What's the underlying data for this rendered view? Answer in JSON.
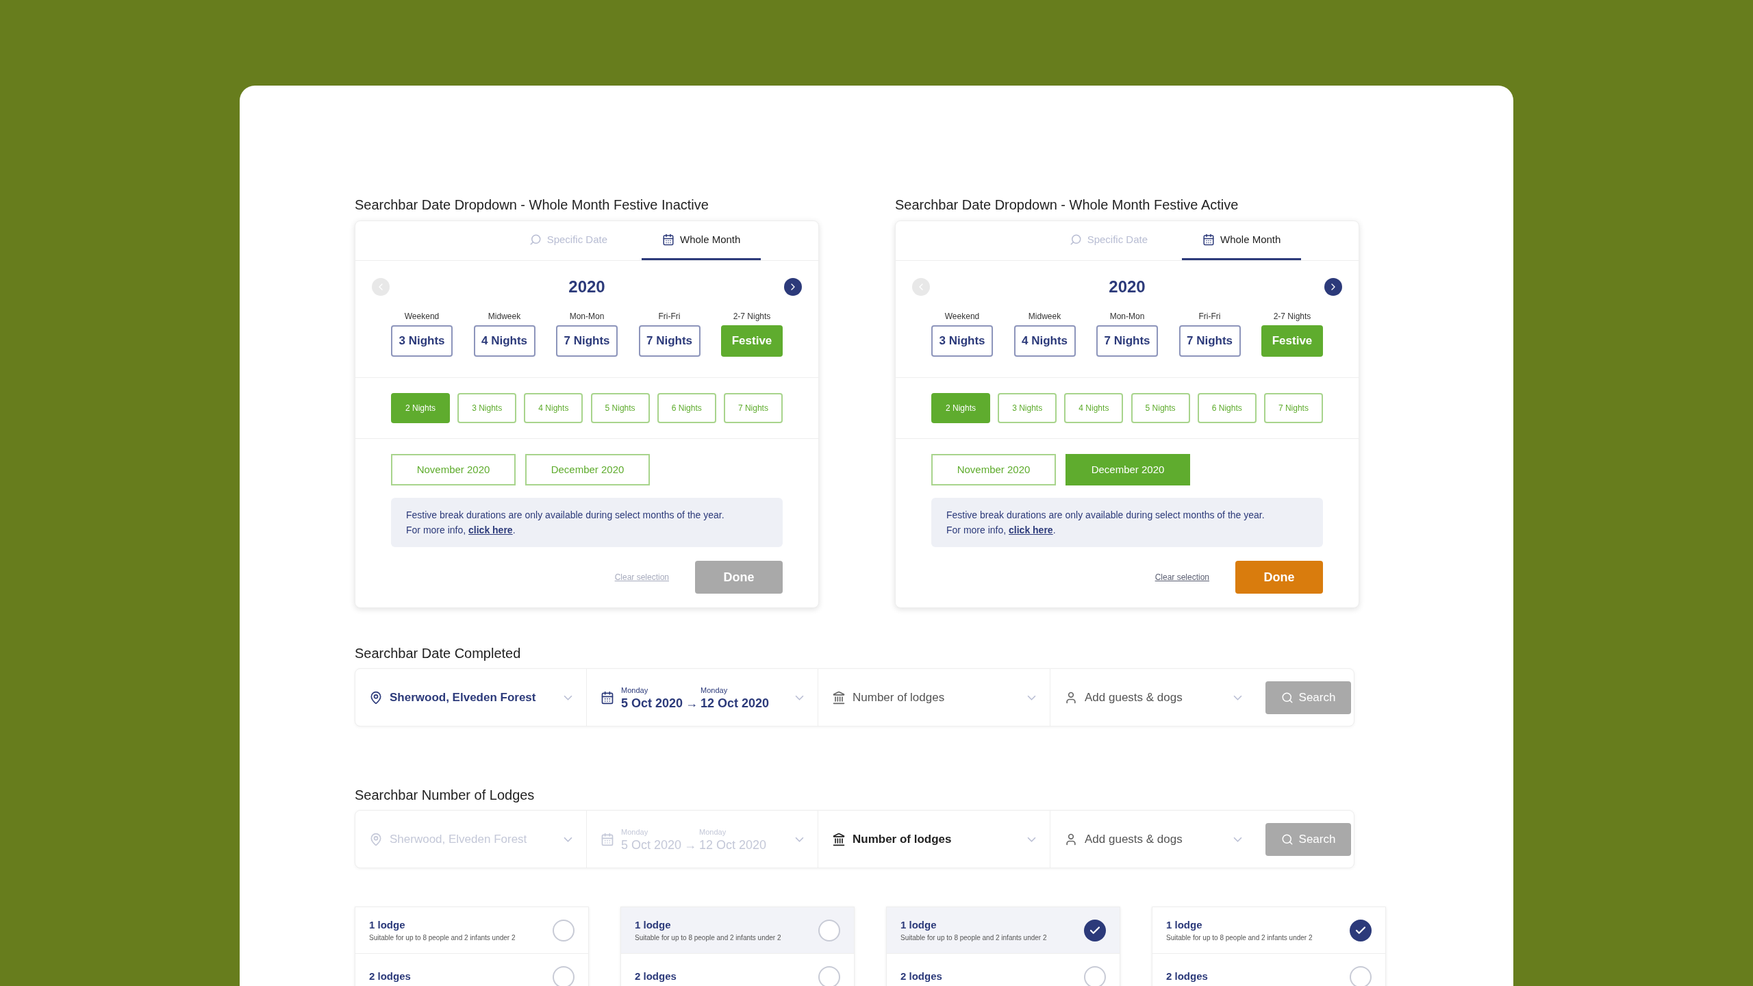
{
  "dropdowns": [
    {
      "title": "Searchbar Date Dropdown - Whole Month Festive Inactive",
      "tabs": [
        {
          "label": "Specific Date",
          "selected": false
        },
        {
          "label": "Whole Month",
          "selected": true
        }
      ],
      "prev": {
        "disabled": true
      },
      "next": {
        "disabled": false
      },
      "year": "2020",
      "durations": [
        {
          "caption": "Weekend",
          "label": "3 Nights",
          "selected": false
        },
        {
          "caption": "Midweek",
          "label": "4 Nights",
          "selected": false
        },
        {
          "caption": "Mon-Mon",
          "label": "7 Nights",
          "selected": false
        },
        {
          "caption": "Fri-Fri",
          "label": "7 Nights",
          "selected": false
        },
        {
          "caption": "2-7 Nights",
          "label": "Festive",
          "selected": true
        }
      ],
      "nights": [
        {
          "label": "2 Nights",
          "selected": true
        },
        {
          "label": "3 Nights",
          "selected": false
        },
        {
          "label": "4 Nights",
          "selected": false
        },
        {
          "label": "5 Nights",
          "selected": false
        },
        {
          "label": "6 Nights",
          "selected": false
        },
        {
          "label": "7 Nights",
          "selected": false
        }
      ],
      "months": [
        {
          "label": "November 2020",
          "selected": false
        },
        {
          "label": "December 2020",
          "selected": false
        }
      ],
      "notice": {
        "line_1": "Festive break durations are only available during select months of the year.",
        "line_2": "For more info,",
        "link": "click here",
        "after": "."
      },
      "clear": {
        "label": "Clear selection",
        "disabled": true
      },
      "done": {
        "label": "Done",
        "disabled": true
      }
    },
    {
      "title": "Searchbar Date Dropdown - Whole Month Festive Active",
      "tabs": [
        {
          "label": "Specific Date",
          "selected": false
        },
        {
          "label": "Whole Month",
          "selected": true
        }
      ],
      "prev": {
        "disabled": true
      },
      "next": {
        "disabled": false
      },
      "year": "2020",
      "durations": [
        {
          "caption": "Weekend",
          "label": "3 Nights",
          "selected": false
        },
        {
          "caption": "Midweek",
          "label": "4 Nights",
          "selected": false
        },
        {
          "caption": "Mon-Mon",
          "label": "7 Nights",
          "selected": false
        },
        {
          "caption": "Fri-Fri",
          "label": "7 Nights",
          "selected": false
        },
        {
          "caption": "2-7 Nights",
          "label": "Festive",
          "selected": true
        }
      ],
      "nights": [
        {
          "label": "2 Nights",
          "selected": true
        },
        {
          "label": "3 Nights",
          "selected": false
        },
        {
          "label": "4 Nights",
          "selected": false
        },
        {
          "label": "5 Nights",
          "selected": false
        },
        {
          "label": "6 Nights",
          "selected": false
        },
        {
          "label": "7 Nights",
          "selected": false
        }
      ],
      "months": [
        {
          "label": "November 2020",
          "selected": false
        },
        {
          "label": "December 2020",
          "selected": true
        }
      ],
      "notice": {
        "line_1": "Festive break durations are only available during select months of the year.",
        "line_2": "For more info,",
        "link": "click here",
        "after": "."
      },
      "clear": {
        "label": "Clear selection",
        "disabled": false
      },
      "done": {
        "label": "Done",
        "disabled": false
      }
    }
  ],
  "searchbars": [
    {
      "title": "Searchbar Date Completed",
      "location": {
        "text": "Sherwood, Elveden Forest",
        "active": true,
        "dimmed": false
      },
      "dates": {
        "day_from": "Monday",
        "date_from": "5 Oct 2020",
        "arrow": "→",
        "day_to": "Monday",
        "date_to": "12 Oct 2020",
        "active": true,
        "dimmed": false
      },
      "lodges": {
        "text": "Number of lodges",
        "active": false,
        "dimmed": false
      },
      "guests": {
        "text": "Add guests & dogs",
        "active": false,
        "dimmed": false
      },
      "search": {
        "label": "Search",
        "disabled": true
      }
    },
    {
      "title": "Searchbar Number of Lodges",
      "location": {
        "text": "Sherwood, Elveden Forest",
        "active": false,
        "dimmed": true
      },
      "dates": {
        "day_from": "Monday",
        "date_from": "5 Oct 2020",
        "arrow": "→",
        "day_to": "Monday",
        "date_to": "12 Oct 2020",
        "active": false,
        "dimmed": true
      },
      "lodges": {
        "text": "Number of lodges",
        "active": true,
        "dimmed": false
      },
      "guests": {
        "text": "Add guests & dogs",
        "active": false,
        "dimmed": false
      },
      "search": {
        "label": "Search",
        "disabled": true
      }
    }
  ],
  "lodge_lists": [
    {
      "options": [
        {
          "label": "1 lodge",
          "note": "Suitable for up to 8 people and 2 infants under 2",
          "highlighted": false,
          "checked": false
        },
        {
          "label": "2 lodges",
          "highlighted": false,
          "checked": false
        }
      ]
    },
    {
      "options": [
        {
          "label": "1 lodge",
          "note": "Suitable for up to 8 people and 2 infants under 2",
          "highlighted": true,
          "checked": false
        },
        {
          "label": "2 lodges",
          "highlighted": false,
          "checked": false
        }
      ]
    },
    {
      "options": [
        {
          "label": "1 lodge",
          "note": "Suitable for up to 8 people and 2 infants under 2",
          "highlighted": true,
          "checked": true
        },
        {
          "label": "2 lodges",
          "highlighted": false,
          "checked": false
        }
      ]
    },
    {
      "options": [
        {
          "label": "1 lodge",
          "note": "Suitable for up to 8 people and 2 infants under 2",
          "highlighted": false,
          "checked": true
        },
        {
          "label": "2 lodges",
          "highlighted": false,
          "checked": false
        }
      ]
    }
  ]
}
